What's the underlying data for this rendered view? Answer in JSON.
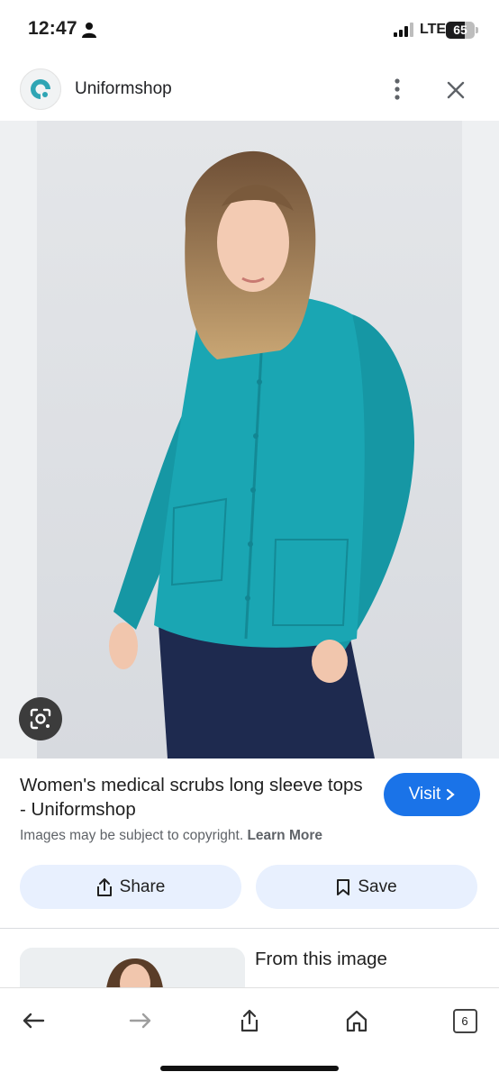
{
  "status_bar": {
    "time": "12:47",
    "network": "LTE",
    "battery_level": "65",
    "battery_fraction": 0.65,
    "icons": [
      "person-icon",
      "signal-icon",
      "battery-icon"
    ]
  },
  "header": {
    "site_name": "Uniformshop",
    "logo_icon": "uniformshop-logo",
    "menu_icon": "more-vertical-icon",
    "close_icon": "close-icon",
    "accent_color": "#2fa5b4"
  },
  "image": {
    "lens_icon": "google-lens-icon",
    "jacket_color": "#1aa6b3",
    "pants_color": "#1e2a4f"
  },
  "result": {
    "title": "Women's medical scrubs long sleeve tops - Uniformshop",
    "visit_label": "Visit",
    "copyright_text": "Images may be subject to copyright.",
    "learn_more": "Learn More",
    "visit_color": "#1a73e8"
  },
  "actions": {
    "share_label": "Share",
    "save_label": "Save"
  },
  "related": {
    "heading": "From this image"
  },
  "bottom_nav": {
    "tab_count": "6",
    "icons": [
      "back-arrow-icon",
      "forward-arrow-icon",
      "share-icon",
      "home-icon",
      "tabs-icon"
    ]
  }
}
